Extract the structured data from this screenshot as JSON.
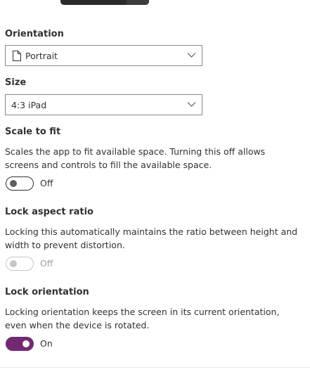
{
  "orientation": {
    "label": "Orientation",
    "value": "Portrait",
    "icon": "page-icon"
  },
  "size": {
    "label": "Size",
    "value": "4:3 iPad"
  },
  "scale_to_fit": {
    "label": "Scale to fit",
    "description": "Scales the app to fit available space. Turning this off allows screens and controls to fill the available space.",
    "state": "Off",
    "enabled": true
  },
  "lock_aspect_ratio": {
    "label": "Lock aspect ratio",
    "description": "Locking this automatically maintains the ratio between height and width to prevent distortion.",
    "state": "Off",
    "enabled": false
  },
  "lock_orientation": {
    "label": "Lock orientation",
    "description": "Locking orientation keeps the screen in its current orientation, even when the device is rotated.",
    "state": "On",
    "enabled": true
  },
  "colors": {
    "accent": "#742774",
    "border": "#8a8886",
    "disabled": "#c8c6c4"
  }
}
